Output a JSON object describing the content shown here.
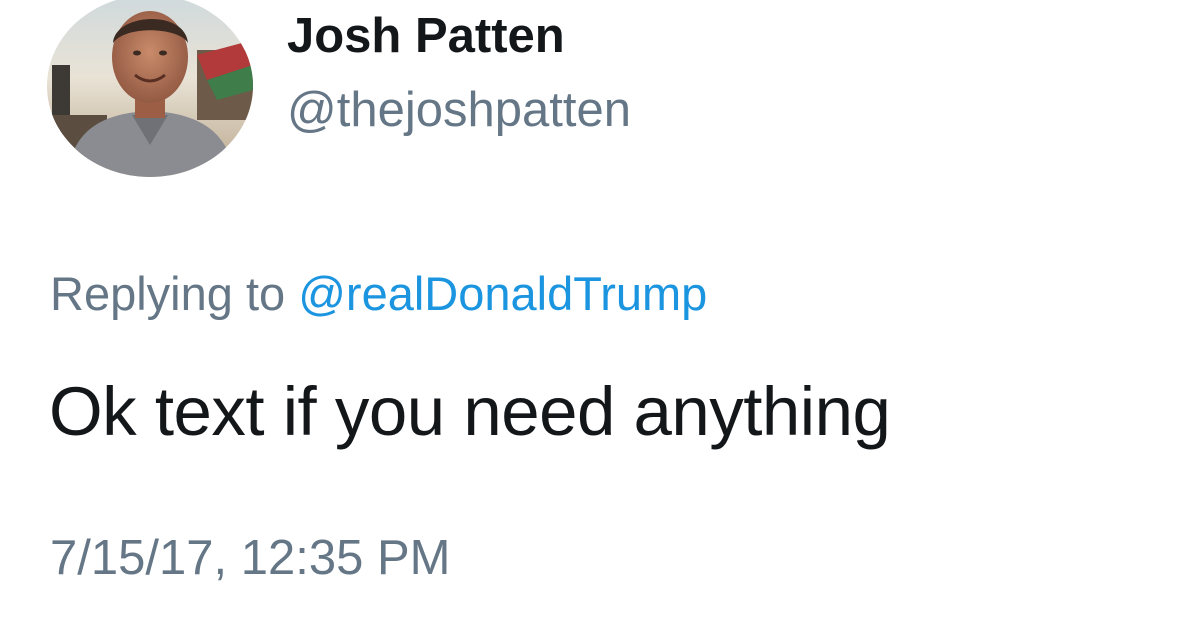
{
  "tweet": {
    "author": {
      "display_name": "Josh Patten",
      "handle": "@thejoshpatten",
      "avatar_icon": "profile-photo"
    },
    "reply": {
      "prefix": "Replying to",
      "mention": "@realDonaldTrump"
    },
    "text": "Ok text if you need anything",
    "timestamp": "7/15/17, 12:35 PM"
  },
  "colors": {
    "primary_text": "#14171a",
    "secondary_text": "#657786",
    "link": "#1b95e0",
    "background": "#ffffff"
  }
}
